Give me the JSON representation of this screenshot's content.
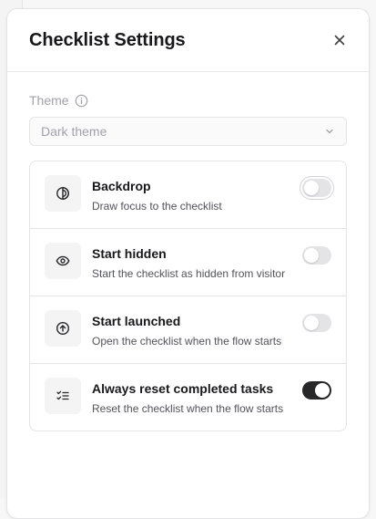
{
  "dialog": {
    "title": "Checklist Settings",
    "close_label": "Close"
  },
  "theme": {
    "label": "Theme",
    "selected": "Dark theme"
  },
  "options": [
    {
      "title": "Backdrop",
      "description": "Draw focus to the checklist",
      "icon": "contrast-icon",
      "enabled": false
    },
    {
      "title": "Start hidden",
      "description": "Start the checklist as hidden from visitor",
      "icon": "eye-icon",
      "enabled": false
    },
    {
      "title": "Start launched",
      "description": "Open the checklist when the flow starts",
      "icon": "arrow-up-circle-icon",
      "enabled": false
    },
    {
      "title": "Always reset completed tasks",
      "description": "Reset the checklist when the flow starts",
      "icon": "list-checks-icon",
      "enabled": true
    }
  ],
  "colors": {
    "toggle_on": "#27272a",
    "toggle_off": "#e4e4e7",
    "muted_text": "#a1a1aa"
  }
}
